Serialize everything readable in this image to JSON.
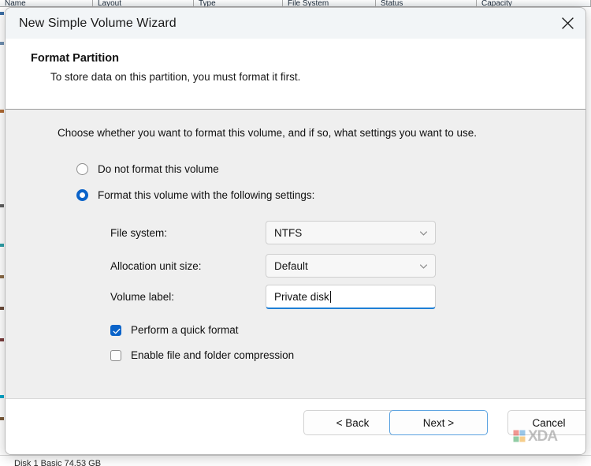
{
  "background": {
    "columns": [
      {
        "label": "Name",
        "width": 118
      },
      {
        "label": "Layout",
        "width": 128
      },
      {
        "label": "Type",
        "width": 113
      },
      {
        "label": "File System",
        "width": 118
      },
      {
        "label": "Status",
        "width": 128
      },
      {
        "label": "Capacity",
        "width": 145
      }
    ],
    "lower_row_text": "Disk 1   Basic   74.53 GB"
  },
  "dialog": {
    "title": "New Simple Volume Wizard",
    "close_icon": "close-icon",
    "header": {
      "title": "Format Partition",
      "subtitle": "To store data on this partition, you must format it first."
    },
    "intro": "Choose whether you want to format this volume, and if so, what settings you want to use.",
    "options": {
      "do_not_format": {
        "label": "Do not format this volume",
        "selected": false
      },
      "format_with_settings": {
        "label": "Format this volume with the following settings:",
        "selected": true
      }
    },
    "fields": {
      "file_system": {
        "label": "File system:",
        "value": "NTFS",
        "chevron_icon": "chevron-down-icon"
      },
      "allocation_unit_size": {
        "label": "Allocation unit size:",
        "value": "Default",
        "chevron_icon": "chevron-down-icon"
      },
      "volume_label": {
        "label": "Volume label:",
        "value": "Private disk",
        "focused": true
      }
    },
    "checkboxes": {
      "quick_format": {
        "label": "Perform a quick format",
        "checked": true,
        "icon": "check-icon"
      },
      "compression": {
        "label": "Enable file and folder compression",
        "checked": false
      }
    },
    "buttons": {
      "back": "< Back",
      "next": "Next >",
      "cancel": "Cancel"
    }
  },
  "watermark": {
    "text": "XDA",
    "logo_icon": "xda-logo-icon"
  },
  "colors": {
    "accent": "#0a63c9",
    "focus_underline": "#1e7fd6",
    "primary_button_border": "#5aa2e0",
    "body_background": "#efefef",
    "titlebar_background": "#f2f5f7"
  }
}
